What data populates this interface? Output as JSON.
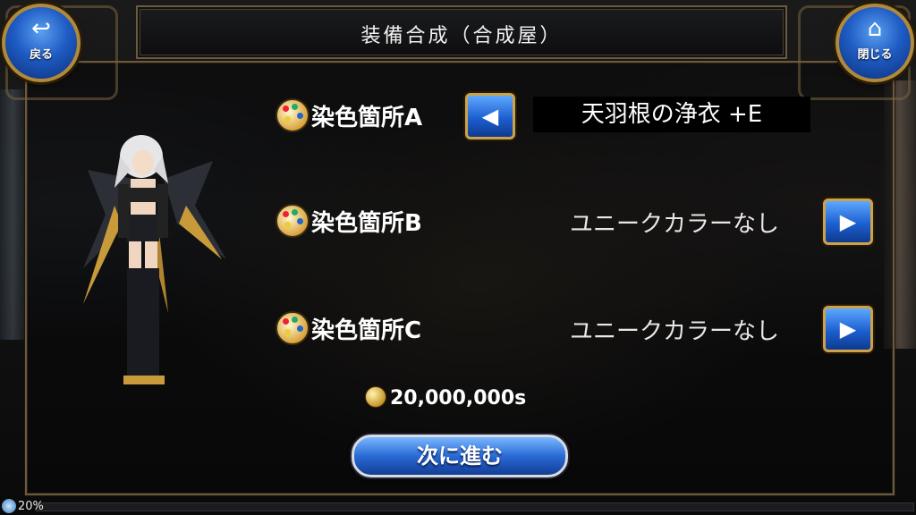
{
  "header": {
    "title": "装備合成（合成屋）",
    "back_label": "戻る",
    "close_label": "閉じる",
    "back_icon": "back-arrow-icon",
    "close_icon": "home-icon"
  },
  "dye_slots": [
    {
      "label": "染色箇所A",
      "value": "天羽根の浄衣 +E",
      "arrow": "left"
    },
    {
      "label": "染色箇所B",
      "value": "ユニークカラーなし",
      "arrow": "right"
    },
    {
      "label": "染色箇所C",
      "value": "ユニークカラーなし",
      "arrow": "right"
    }
  ],
  "cost": {
    "amount": "20,000,000s"
  },
  "next_button": {
    "label": "次に進む"
  },
  "status": {
    "percent": "20%"
  },
  "colors": {
    "button_blue": "#1f5cc4",
    "frame_gold": "#b08a3a"
  }
}
